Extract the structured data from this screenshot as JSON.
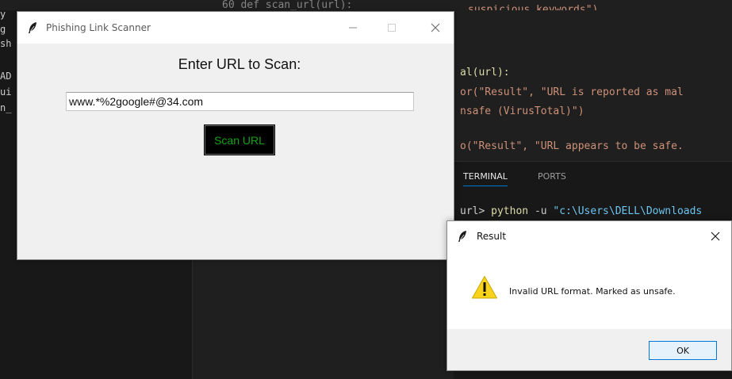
{
  "editor": {
    "center_top_code": "60    def scan_url(url):",
    "right_top_code": "suspicious_keywords\")",
    "left_strip_lines": [
      "y",
      "g",
      "sh",
      "AD",
      "ui",
      "n_"
    ],
    "code_lines": [
      "al(url):",
      "or(\"Result\", \"URL is reported as mal",
      "nsafe (VirusTotal)\")",
      "o(\"Result\", \"URL appears to be safe."
    ],
    "panel_tabs": [
      "TERMINAL",
      "PORTS"
    ],
    "terminal": {
      "prompt": "url>",
      "command": "python",
      "flag": "-u",
      "path": "\"c:\\Users\\DELL\\Downloads"
    }
  },
  "main_window": {
    "title": "Phishing Link Scanner",
    "prompt_label": "Enter URL to Scan:",
    "url_value": "www.*%2google#@34.com",
    "scan_button_label": "Scan URL"
  },
  "result_dialog": {
    "title": "Result",
    "message": "Invalid URL format. Marked as unsafe.",
    "ok_label": "OK",
    "icon": "warning-icon"
  },
  "colors": {
    "scan_button_bg": "#000000",
    "scan_button_text": "#12a312",
    "warning_yellow": "#f8d21c",
    "ok_border": "#0078d7"
  }
}
